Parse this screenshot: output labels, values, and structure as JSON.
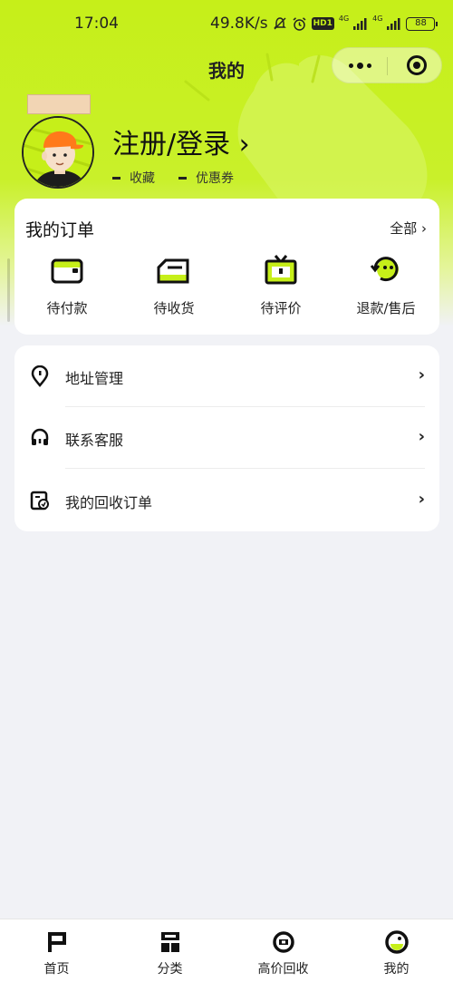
{
  "status_bar": {
    "time": "17:04",
    "net_speed": "49.8K/s",
    "hd_label": "HD1",
    "net1": "4G",
    "net2": "4G",
    "battery": "88"
  },
  "header": {
    "title": "我的"
  },
  "profile": {
    "login_label": "注册/登录 ›",
    "favorites_label": "收藏",
    "coupons_label": "优惠券"
  },
  "orders": {
    "title": "我的订单",
    "all_label": "全部 ›",
    "items": [
      {
        "label": "待付款",
        "icon": "wallet-icon"
      },
      {
        "label": "待收货",
        "icon": "delivery-truck-icon"
      },
      {
        "label": "待评价",
        "icon": "tv-review-icon"
      },
      {
        "label": "退款/售后",
        "icon": "refund-icon"
      }
    ]
  },
  "menu": {
    "items": [
      {
        "label": "地址管理",
        "icon": "location-pin-icon"
      },
      {
        "label": "联系客服",
        "icon": "headset-icon"
      },
      {
        "label": "我的回收订单",
        "icon": "recycle-order-icon"
      }
    ],
    "chevron": "›"
  },
  "tab_bar": {
    "tabs": [
      {
        "label": "首页",
        "icon": "home-icon"
      },
      {
        "label": "分类",
        "icon": "category-icon"
      },
      {
        "label": "高价回收",
        "icon": "recycle-icon"
      },
      {
        "label": "我的",
        "icon": "profile-icon",
        "active": true
      }
    ]
  },
  "colors": {
    "accent": "#c6ef19",
    "background": "#f1f2f6",
    "text": "#222222"
  }
}
